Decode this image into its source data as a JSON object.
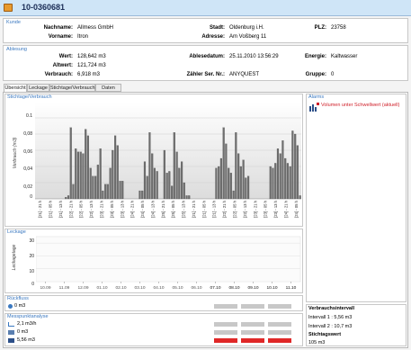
{
  "window": {
    "title": "10-0360681"
  },
  "kunde": {
    "caption": "Kunde",
    "nachname_label": "Nachname:",
    "nachname": "Allmess GmbH",
    "vorname_label": "Vorname:",
    "vorname": "Itron",
    "stadt_label": "Stadt:",
    "stadt": "Oldenburg i.H.",
    "adresse_label": "Adresse:",
    "adresse": "Am Voßberg 11",
    "plz_label": "PLZ:",
    "plz": "23758"
  },
  "ablesung": {
    "caption": "Ablesung",
    "wert_label": "Wert:",
    "wert": "128,642 m3",
    "altwert_label": "Altwert:",
    "altwert": "121,724 m3",
    "verbrauch_label": "Verbrauch:",
    "verbrauch": "6,918 m3",
    "datum_label": "Ablesedatum:",
    "datum": "25.11.2010 13:56:29",
    "zaehler_label": "Zähler Ser. Nr.:",
    "zaehler": "ANYQUEST",
    "energie_label": "Energie:",
    "energie": "Kaltwasser",
    "gruppe_label": "Gruppe:",
    "gruppe": "0"
  },
  "tabs": [
    "Übersicht",
    "Leckage",
    "Stichtage/Verbrauch",
    "Daten"
  ],
  "stichtage": {
    "title": "Stichtage/Verbrauch",
    "ylabel": "Verbrauch (m3)",
    "ytick_labels": [
      "0.1",
      "0,08",
      "0,06",
      "0,04",
      "0,02",
      "0"
    ]
  },
  "leckage": {
    "title": "Leckage",
    "ylabel": "Leckagetage",
    "ytick_labels": [
      "30",
      "20",
      "10",
      "0"
    ],
    "xtick_labels": [
      "10.09",
      "11.09",
      "12.09",
      "01.10",
      "02.10",
      "03.10",
      "04.10",
      "05.10",
      "06.10",
      "07.10",
      "08.10",
      "09.10",
      "10.10",
      "11.10"
    ]
  },
  "rueckfluss": {
    "title": "Rückfluss",
    "value": "0 m3"
  },
  "messpunkt": {
    "title": "Messpunktanalyse",
    "rows": [
      {
        "value": "2,1 m3/h"
      },
      {
        "value": "0 m3"
      },
      {
        "value": "5,56 m3"
      }
    ]
  },
  "alarms": {
    "title": "Alarms",
    "item": "Volumen unter Schwellwert (aktuell)"
  },
  "verbrauchsintervall": {
    "title": "Verbrauchsintervall",
    "intervall1": "Intervall 1 : 5,56 m3",
    "intervall2": "Intervall 2 : 10,7 m3",
    "stichtagswert_label": "Stichtagswert",
    "stichtagswert": "105 m3"
  },
  "colors": {
    "header": "#cfe5f7",
    "caption": "#3a78c0",
    "bar": "#6e6e6e",
    "alarm": "#d0202a",
    "warn": "#e02828"
  },
  "chart_data": [
    {
      "type": "bar",
      "title": "Stichtage/Verbrauch",
      "ylabel": "Verbrauch (m3)",
      "ylim": [
        0,
        0.12
      ],
      "categories": [
        "[21] - 21 h",
        "[21] - 05 h",
        "[21] - 13 h",
        "[22] - 21 h",
        "[22] - 05 h",
        "[22] - 13 h",
        "[23] - 21 h",
        "[23] - 05 h",
        "[23] - 13 h",
        "[24] - 21 h",
        "[24] - 05 h",
        "[24] - 13 h",
        "[25] - 21 h",
        "[25] - 05 h",
        "[25] - 13 h"
      ],
      "values": [
        0,
        0,
        0,
        0,
        0,
        0,
        0,
        0,
        0,
        0,
        0,
        0,
        0.002,
        0.004,
        0.088,
        0.018,
        0.062,
        0.058,
        0.058,
        0.056,
        0.086,
        0.078,
        0.038,
        0.028,
        0.028,
        0.042,
        0.062,
        0.01,
        0.018,
        0.018,
        0.038,
        0.06,
        0.078,
        0.066,
        0.022,
        0.022,
        0,
        0,
        0,
        0,
        0,
        0,
        0.01,
        0.01,
        0.046,
        0.028,
        0.082,
        0.056,
        0.038,
        0.034,
        0,
        0,
        0.06,
        0.032,
        0.034,
        0.016,
        0.082,
        0.058,
        0.038,
        0.046,
        0.02,
        0.004,
        0.004,
        0,
        0,
        0,
        0,
        0,
        0,
        0,
        0,
        0,
        0,
        0.038,
        0.04,
        0.05,
        0.088,
        0.068,
        0.038,
        0.032,
        0.01,
        0.082,
        0.056,
        0.04,
        0.048,
        0.026,
        0.028,
        0,
        0,
        0,
        0,
        0,
        0,
        0,
        0,
        0.04,
        0.038,
        0.044,
        0.062,
        0.056,
        0.072,
        0.05,
        0.044,
        0.04,
        0.084,
        0.08,
        0.066,
        0.004
      ],
      "grid": true
    },
    {
      "type": "bar",
      "title": "Leckage",
      "ylabel": "Leckagetage",
      "ylim": [
        0,
        35
      ],
      "categories": [
        "10.09",
        "11.09",
        "12.09",
        "01.10",
        "02.10",
        "03.10",
        "04.10",
        "05.10",
        "06.10",
        "07.10",
        "08.10",
        "09.10",
        "10.10",
        "11.10"
      ],
      "values": [
        0,
        0,
        0,
        0,
        0,
        0,
        0,
        0,
        0,
        0,
        0,
        0,
        0,
        0
      ]
    }
  ]
}
